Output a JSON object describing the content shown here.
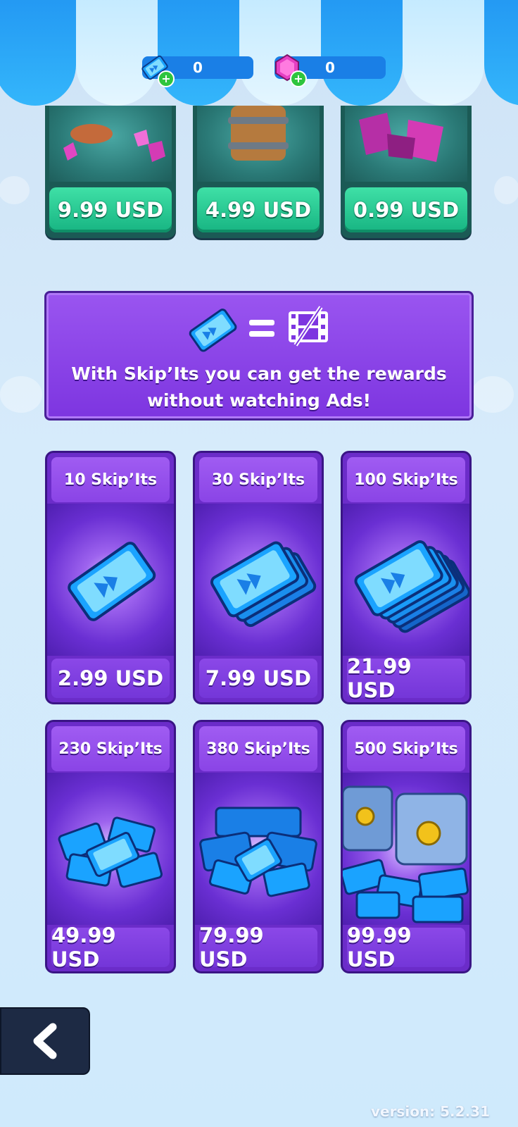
{
  "currencies": {
    "skipits": {
      "value": "0",
      "icon": "skip-ticket-icon"
    },
    "gems": {
      "value": "0",
      "icon": "gem-icon"
    }
  },
  "gem_offers": [
    {
      "price": "9.99 USD"
    },
    {
      "price": "4.99 USD"
    },
    {
      "price": "0.99 USD"
    }
  ],
  "banner": {
    "text_line1": "With Skip’Its you can  get the rewards",
    "text_line2": "without watching Ads!"
  },
  "skipit_offers": [
    {
      "title": "10 Skip’Its",
      "price": "2.99 USD"
    },
    {
      "title": "30 Skip’Its",
      "price": "7.99 USD"
    },
    {
      "title": "100 Skip’Its",
      "price": "21.99 USD"
    },
    {
      "title": "230 Skip’Its",
      "price": "49.99 USD"
    },
    {
      "title": "380 Skip’Its",
      "price": "79.99 USD"
    },
    {
      "title": "500 Skip’Its",
      "price": "99.99 USD"
    }
  ],
  "version": "version: 5.2.31",
  "colors": {
    "awning_blue": "#1d8ef0",
    "awning_white": "#e4f6ff",
    "green_button": "#17b482",
    "purple_card": "#6b2cc9"
  }
}
